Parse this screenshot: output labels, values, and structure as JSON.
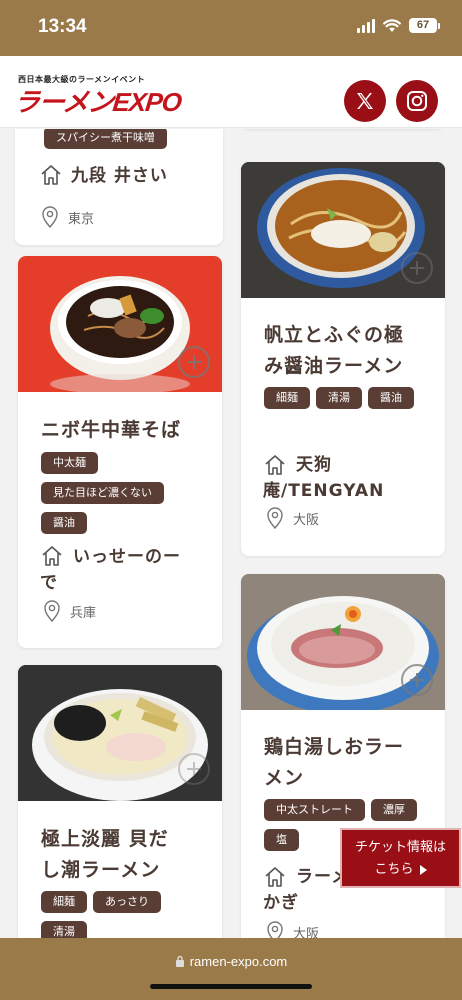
{
  "status_bar": {
    "time": "13:34",
    "battery": "67"
  },
  "header": {
    "logo_sub": "西日本最大級のラーメンイベント",
    "logo_main": "ラーメンEXPO",
    "social": [
      {
        "name": "x",
        "icon": "x-logo-icon"
      },
      {
        "name": "instagram",
        "icon": "instagram-icon"
      }
    ]
  },
  "cards": {
    "c0": {
      "tags": [
        "スパイシー煮干味噌"
      ],
      "shop": "九段 井さい",
      "location": "東京"
    },
    "c1": {
      "title_lines": [
        "ニボ牛中華そば"
      ],
      "tags": [
        "中太麺",
        "見た目ほど濃くない",
        "醤油"
      ],
      "shop_lines": [
        "いっせーのー",
        "で"
      ],
      "location": "兵庫"
    },
    "c2": {
      "title_lines": [
        "極上淡麗 貝だ",
        "し潮ラーメン"
      ],
      "tags": [
        "細麺",
        "あっさり",
        "清湯"
      ]
    },
    "c3": {
      "title_lines": [
        "帆立とふぐの極",
        "み醤油ラーメン"
      ],
      "tags": [
        "細麺",
        "清湯",
        "醤油"
      ],
      "shop_lines": [
        "天狗",
        "庵/TENGYAN"
      ],
      "location": "大阪"
    },
    "c4": {
      "title_lines": [
        "鶏白湯しおラー",
        "メン"
      ],
      "tags": [
        "中太ストレート",
        "濃厚",
        "塩"
      ],
      "shop_lines": [
        "ラーメン",
        "かぎ"
      ],
      "location": "大阪"
    }
  },
  "ticket": {
    "line1": "チケット情報は",
    "line2": "こちら"
  },
  "url_bar": {
    "url": "ramen-expo.com"
  },
  "colors": {
    "brand_red": "#9a0e16",
    "logo_red": "#c4141c",
    "gold": "#9b7a4a",
    "tag_brown": "#5a3d34",
    "text_brown": "#4a3a33"
  }
}
